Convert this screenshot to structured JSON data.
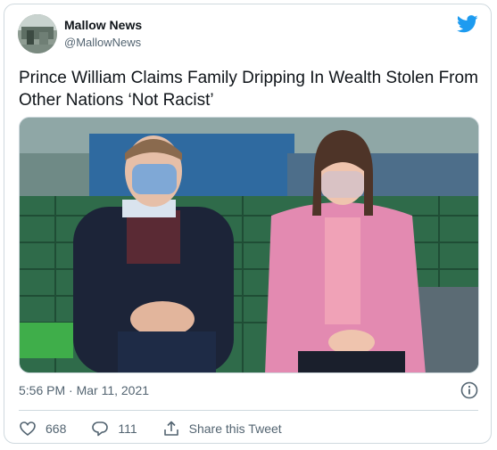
{
  "account": {
    "name": "Mallow News",
    "handle": "@MallowNews"
  },
  "tweet": {
    "text": "Prince William Claims Family Dripping  In Wealth Stolen From Other Nations ‘Not Racist’",
    "timestamp": "5:56 PM · Mar 11, 2021"
  },
  "engagement": {
    "likes": "668",
    "replies": "111",
    "share_label": "Share this Tweet"
  },
  "icons": {
    "brand": "twitter-bird-icon",
    "info": "info-icon",
    "like": "heart-icon",
    "reply": "speech-bubble-icon",
    "share": "share-upload-icon"
  },
  "colors": {
    "brand": "#1d9bf0",
    "text_primary": "#0f1419",
    "text_secondary": "#536471",
    "border": "#cfd9de"
  }
}
